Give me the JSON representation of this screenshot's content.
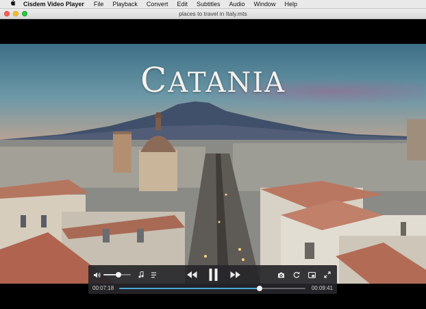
{
  "menubar": {
    "app_name": "Cisdem Video Player",
    "items": [
      "File",
      "Playback",
      "Convert",
      "Edit",
      "Subtitles",
      "Audio",
      "Window",
      "Help"
    ]
  },
  "window": {
    "title": "places to travel in Italy.mts"
  },
  "video": {
    "overlay_text": "CATANIA"
  },
  "player": {
    "current_time": "00:07:18",
    "duration": "00:09:41",
    "progress": 0.754,
    "volume": 0.55,
    "icons": [
      "volume-icon",
      "music-note-icon",
      "playlist-icon",
      "rewind-icon",
      "pause-icon",
      "fast-forward-icon",
      "camera-icon",
      "rotate-icon",
      "picture-in-picture-icon",
      "fullscreen-icon"
    ]
  },
  "colors": {
    "accent": "#4ea8d8",
    "traffic_red": "#fc5f57",
    "traffic_yellow": "#fdbc2e",
    "traffic_green": "#28c840"
  }
}
